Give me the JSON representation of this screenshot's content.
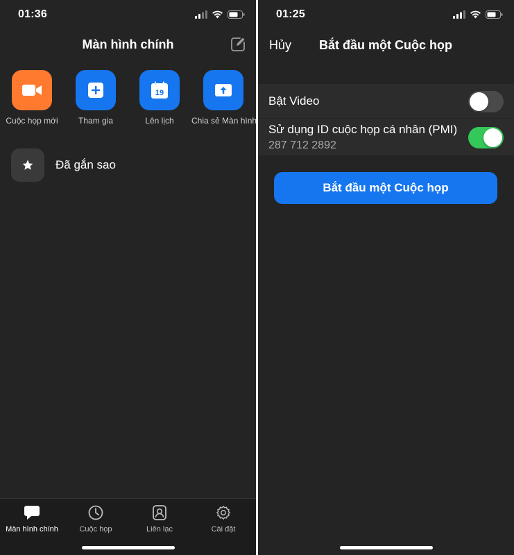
{
  "left_screen": {
    "status_time": "01:36",
    "title": "Màn hình chính",
    "actions": [
      {
        "label": "Cuộc họp mới",
        "icon": "video-camera-icon",
        "color": "#ff7a2e"
      },
      {
        "label": "Tham gia",
        "icon": "plus-icon",
        "color": "#1676f0"
      },
      {
        "label": "Lên lịch",
        "icon": "calendar-icon",
        "color": "#1676f0",
        "calendar_day": "19"
      },
      {
        "label": "Chia sẻ Màn hình",
        "icon": "share-up-arrow-icon",
        "color": "#1676f0"
      }
    ],
    "starred": {
      "label": "Đã gắn sao",
      "icon": "star-icon"
    },
    "tabs": [
      {
        "label": "Màn hình chính",
        "icon": "chat-bubble-icon",
        "active": true
      },
      {
        "label": "Cuộc họp",
        "icon": "clock-icon",
        "active": false
      },
      {
        "label": "Liên lạc",
        "icon": "contact-icon",
        "active": false
      },
      {
        "label": "Cài đặt",
        "icon": "gear-icon",
        "active": false
      }
    ]
  },
  "right_screen": {
    "status_time": "01:25",
    "cancel_label": "Hủy",
    "title": "Bắt đầu một Cuộc họp",
    "video_setting": {
      "label": "Bật Video",
      "enabled": false
    },
    "pmi_setting": {
      "label": "Sử dụng ID cuộc họp cá nhân (PMI)",
      "pmi": "287 712 2892",
      "enabled": true
    },
    "start_button": "Bắt đầu một Cuộc họp"
  },
  "colors": {
    "background": "#242424",
    "accent_blue": "#1676f0",
    "accent_orange": "#ff7a2e",
    "toggle_on": "#34c759"
  }
}
